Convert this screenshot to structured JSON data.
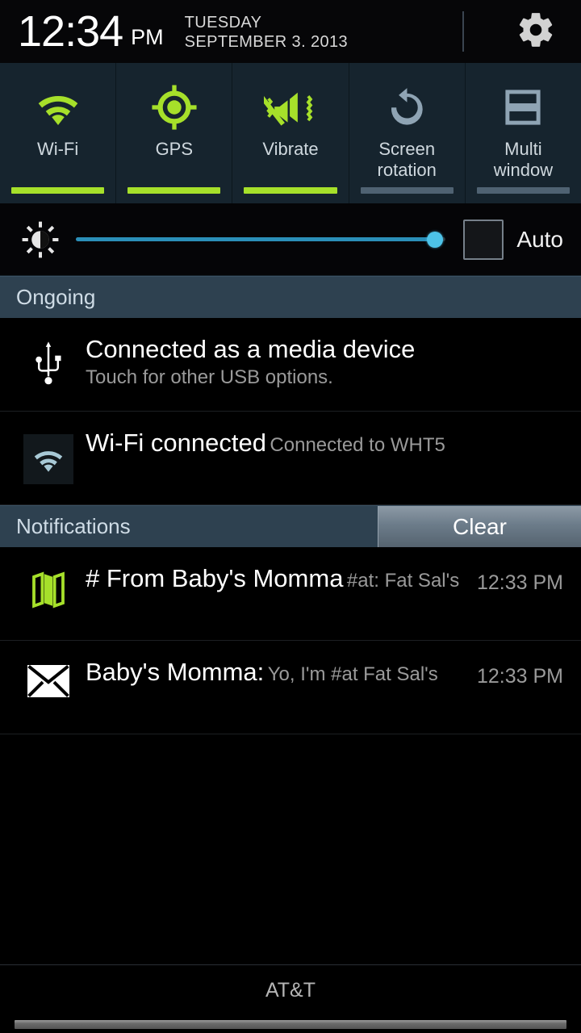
{
  "statusbar": {
    "time": "12:34",
    "ampm": "PM",
    "day_of_week": "TUESDAY",
    "date": "SEPTEMBER 3. 2013",
    "settings_icon": "gear-icon"
  },
  "quick_settings": {
    "tiles": [
      {
        "label": "Wi-Fi",
        "icon": "wifi-icon",
        "state": "on"
      },
      {
        "label": "GPS",
        "icon": "gps-crosshair-icon",
        "state": "on"
      },
      {
        "label": "Vibrate",
        "icon": "vibrate-mute-icon",
        "state": "on"
      },
      {
        "label": "Screen\nrotation",
        "label_line1": "Screen",
        "label_line2": "rotation",
        "icon": "rotate-ccw-icon",
        "state": "off"
      },
      {
        "label": "Multi\nwindow",
        "label_line1": "Multi",
        "label_line2": "window",
        "icon": "multi-window-icon",
        "state": "off"
      }
    ],
    "on_color": "#a6e02a",
    "off_color": "#7f95a6",
    "tile_background": "#16242e"
  },
  "brightness": {
    "icon": "brightness-icon",
    "value_percent": 97,
    "track_color": "#2b8fb8",
    "thumb_color": "#4dc3e8",
    "auto_label": "Auto",
    "auto_checked": false
  },
  "sections": {
    "ongoing": {
      "title": "Ongoing",
      "items": [
        {
          "icon": "usb-icon",
          "title": "Connected as a media device",
          "subtitle": "Touch for other USB options.",
          "time": ""
        },
        {
          "icon": "wifi-connected-icon",
          "title": "Wi-Fi connected",
          "subtitle": "Connected to WHT5",
          "time": ""
        }
      ]
    },
    "notifications": {
      "title": "Notifications",
      "clear_label": "Clear",
      "items": [
        {
          "icon": "map-icon",
          "title": "# From Baby's Momma",
          "subtitle": "#at: Fat Sal's",
          "time": "12:33 PM"
        },
        {
          "icon": "envelope-icon",
          "title": "Baby's Momma:",
          "subtitle": "Yo, I'm #at Fat Sal's",
          "time": "12:33 PM"
        }
      ]
    }
  },
  "footer": {
    "carrier": "AT&T",
    "handle": "drag-handle"
  }
}
